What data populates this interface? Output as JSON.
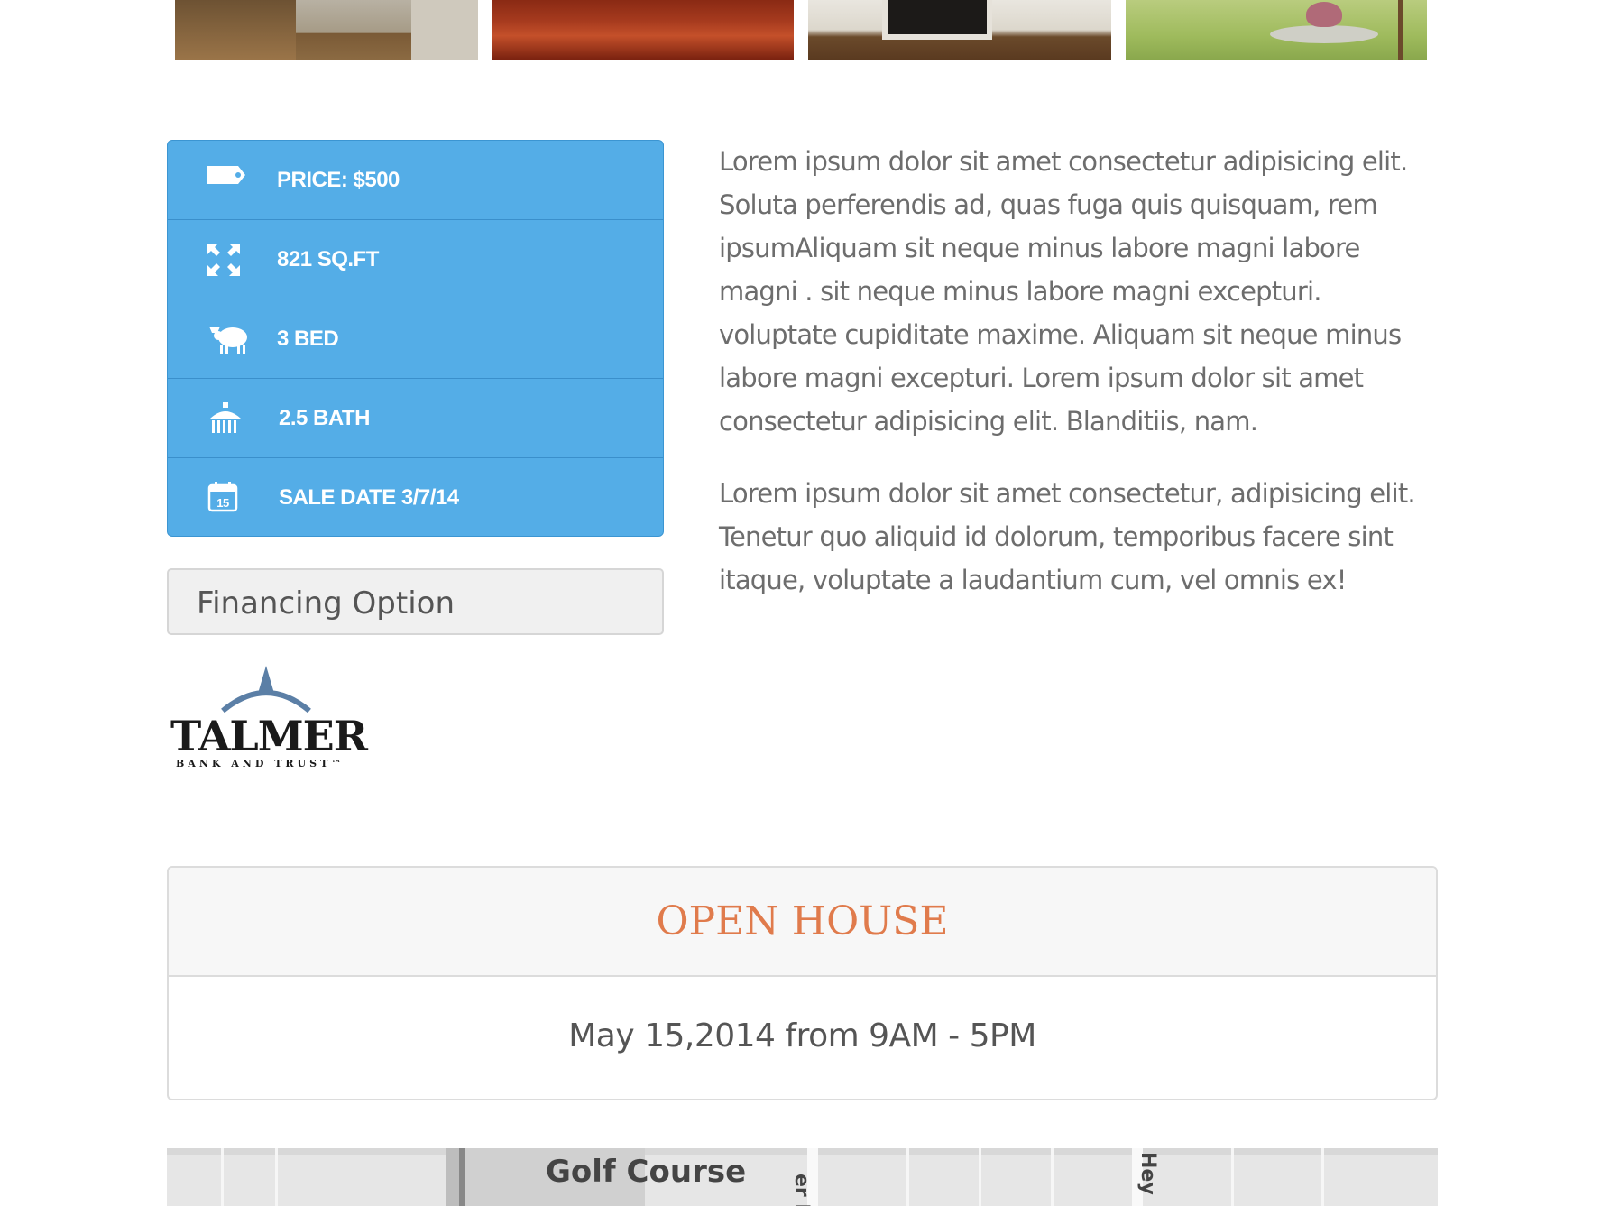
{
  "gallery": {
    "thumbnails": [
      "interior-room-photo",
      "hardwood-floor-photo",
      "fireplace-room-photo",
      "front-yard-photo"
    ]
  },
  "features": [
    {
      "icon": "price-tag-icon",
      "label": "PRICE: $500"
    },
    {
      "icon": "expand-arrows-icon",
      "label": "821 SQ.FT"
    },
    {
      "icon": "bed-icon",
      "label": "3 BED"
    },
    {
      "icon": "shower-icon",
      "label": "2.5 BATH"
    },
    {
      "icon": "calendar-icon",
      "label": "SALE DATE 3/7/14",
      "calendar_day": "15"
    }
  ],
  "financing": {
    "label": "Financing Option"
  },
  "logo": {
    "name": "TALMER",
    "tagline": "BANK AND TRUST™"
  },
  "description": {
    "paragraphs": [
      "Lorem ipsum dolor sit amet consectetur adipisicing elit. Soluta perferendis ad, quas fuga quis quisquam, rem ipsumAliquam sit neque minus labore magni labore magni . sit neque minus labore magni excepturi. voluptate cupiditate maxime. Aliquam sit neque minus labore magni excepturi. Lorem ipsum dolor sit amet consectetur adipisicing elit. Blanditiis, nam.",
      "Lorem ipsum dolor sit amet consectetur, adipisicing elit. Tenetur quo aliquid id dolorum, temporibus facere sint itaque, voluptate a laudantium cum, vel omnis ex!"
    ]
  },
  "open_house": {
    "title": "OPEN HOUSE",
    "date": "May 15,2014 from 9AM - 5PM"
  },
  "map": {
    "labels": [
      "Golf Course",
      "er R",
      "Hey"
    ]
  },
  "colors": {
    "feature_bg": "#54ade7",
    "open_house_title": "#e07b4c",
    "text": "#6d6d6d"
  }
}
